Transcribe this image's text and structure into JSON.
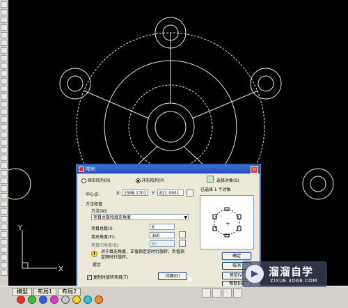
{
  "canvas": {
    "ucs_y": "Y",
    "ucs_x": "X"
  },
  "dialog": {
    "title": "阵列",
    "rect_array_label": "矩形阵列(R)",
    "polar_array_label": "环形阵列(P)",
    "select_objects_label": "选择对象(S)",
    "selected_count": "已选择 1 个对象",
    "center_label": "中心点:",
    "center_x_label": "X:",
    "center_x": "1588.1701",
    "center_y_label": "Y:",
    "center_y": "821.0951",
    "method_group": "方法和值",
    "method_label": "方法(M):",
    "method_value": "项目总数和填充角度",
    "total_items_label": "项目总数(I):",
    "total_items": "6",
    "fill_angle_label": "填充角度(F):",
    "fill_angle": "360",
    "item_angle_label": "项目间角度(B):",
    "item_angle": "60",
    "tip_text": "对于填充角度，正值指定逆时针旋转，负值指定顺时针旋转。",
    "tip_label": "提示",
    "rotate_label": "复制时旋转项目(T)",
    "more_button": "详细(O)",
    "ok_button": "确定",
    "cancel_button": "取消",
    "preview_button": "预览(V)",
    "help_button": "帮助(H)"
  },
  "bottom": {
    "tabs": [
      "模型",
      "布局1",
      "布局2"
    ],
    "colors": [
      "#ff2a2a",
      "#28c828",
      "#2a5aff",
      "#ff2ad8",
      "#c8c8c8",
      "#ffd21e",
      "#1ec8e6",
      "#ff8a1e"
    ]
  },
  "watermark": {
    "brand": "溜溜自学",
    "url": "ZIXUE.3D66.COM"
  }
}
